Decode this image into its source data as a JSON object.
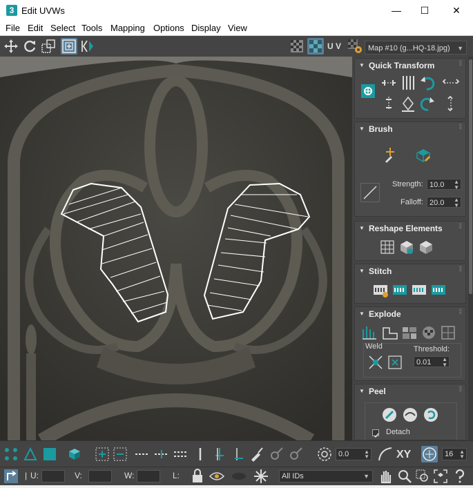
{
  "window": {
    "title": "Edit UVWs",
    "app_icon": "3",
    "minimize": "—",
    "maximize": "☐",
    "close": "✕"
  },
  "menu": [
    "File",
    "Edit",
    "Select",
    "Tools",
    "Mapping",
    "Options",
    "Display",
    "View"
  ],
  "toolbar": {
    "uv_label": "U V",
    "map_select": "Map #10 (g...HQ-18.jpg)"
  },
  "rollouts": {
    "quick_transform": "Quick Transform",
    "brush": "Brush",
    "strength_label": "Strength:",
    "strength_value": "10.0",
    "falloff_label": "Falloff:",
    "falloff_value": "20.0",
    "reshape": "Reshape Elements",
    "stitch": "Stitch",
    "explode": "Explode",
    "weld_label": "Weld",
    "threshold_label": "Threshold:",
    "threshold_value": "0.01",
    "peel": "Peel",
    "detach_label": "Detach"
  },
  "bottom": {
    "rotation_value": "0.0",
    "xy_label": "XY",
    "grid_value": "16",
    "u_label": "U:",
    "v_label": "V:",
    "w_label": "W:",
    "l_label": "L:",
    "ids_select": "All IDs"
  },
  "colors": {
    "accent": "#1b9aa0",
    "selection": "#ffffff",
    "panel": "#444444"
  }
}
